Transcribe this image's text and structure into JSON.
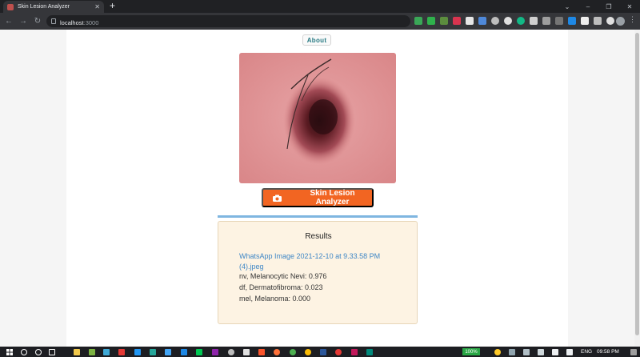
{
  "browser": {
    "tab_title": "Skin Lesion Analyzer",
    "url_host": "localhost",
    "url_port": ":3000"
  },
  "page": {
    "about_label": "About",
    "analyze_button_label": "Skin Lesion Analyzer",
    "results": {
      "title": "Results",
      "file_name": "WhatsApp Image 2021-12-10 at 9.33.58 PM (4).jpeg",
      "predictions": [
        "nv, Melanocytic Nevi: 0.976",
        "df, Dermatofibroma: 0.023",
        "mel, Melanoma: 0.000"
      ]
    }
  },
  "taskbar": {
    "battery": "100%",
    "language": "ENG",
    "time": "09:58 PM"
  },
  "colors": {
    "accent_button": "#f26522",
    "results_background": "#fdf3e3",
    "results_rule": "#7fb6e0",
    "link": "#3f87c6"
  }
}
